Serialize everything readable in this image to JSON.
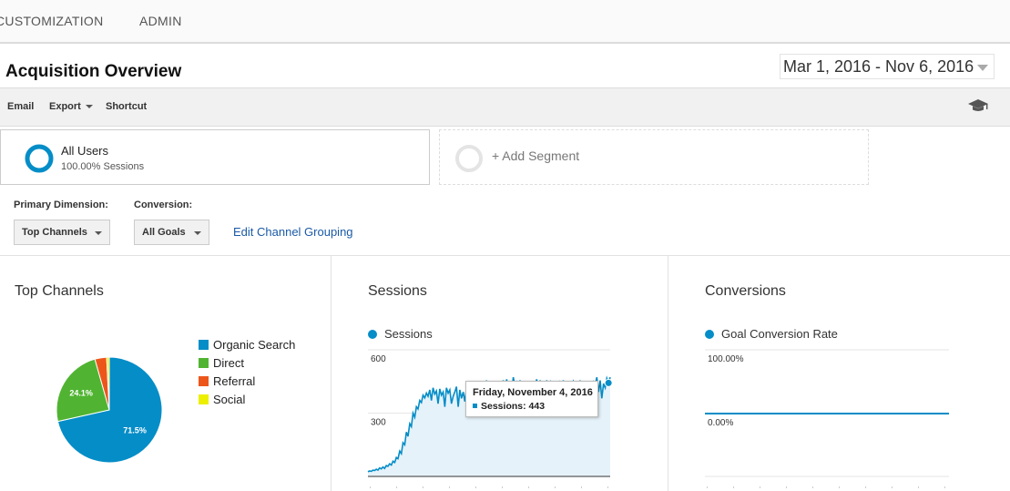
{
  "nav": {
    "items": [
      "CUSTOMIZATION",
      "ADMIN"
    ]
  },
  "page": {
    "title": "Acquisition Overview",
    "date_range": "Mar 1, 2016 - Nov 6, 2016"
  },
  "toolbar": {
    "email": "Email",
    "export": "Export",
    "shortcut": "Shortcut",
    "icon": "graduation-cap-icon"
  },
  "segments": {
    "all_users": {
      "title": "All Users",
      "subtitle": "100.00% Sessions"
    },
    "add_label": "+ Add Segment"
  },
  "dimension": {
    "primary_label": "Primary Dimension:",
    "primary_value": "Top Channels",
    "conversion_label": "Conversion:",
    "conversion_value": "All Goals",
    "edit_link": "Edit Channel Grouping"
  },
  "colors": {
    "accent": "#058dc7",
    "direct": "#50b432",
    "referral": "#ed561b",
    "social": "#edef00",
    "link": "#1a5aa6"
  },
  "panels": {
    "top_channels": {
      "title": "Top Channels"
    },
    "sessions": {
      "title": "Sessions",
      "legend": "Sessions",
      "tooltip": {
        "date": "Friday, November 4, 2016",
        "label": "Sessions:",
        "value": "443"
      }
    },
    "conversions": {
      "title": "Conversions",
      "legend": "Goal Conversion Rate"
    }
  },
  "chart_data": [
    {
      "type": "pie",
      "title": "Top Channels",
      "series": [
        {
          "name": "Organic Search",
          "value": 71.5,
          "label": "71.5%",
          "color": "#058dc7"
        },
        {
          "name": "Direct",
          "value": 24.1,
          "label": "24.1%",
          "color": "#50b432"
        },
        {
          "name": "Referral",
          "value": 3.6,
          "color": "#ed561b"
        },
        {
          "name": "Social",
          "value": 0.8,
          "color": "#edef00"
        }
      ]
    },
    {
      "type": "area",
      "title": "Sessions",
      "ylim": [
        0,
        600
      ],
      "yticks": [
        {
          "value": 600,
          "label": "600"
        },
        {
          "value": 300,
          "label": "300"
        }
      ],
      "series": [
        {
          "name": "Sessions",
          "values": [
            22,
            26,
            24,
            30,
            28,
            34,
            30,
            40,
            36,
            45,
            38,
            52,
            48,
            60,
            54,
            72,
            66,
            90,
            84,
            120,
            108,
            160,
            150,
            210,
            190,
            250,
            236,
            300,
            280,
            330,
            320,
            360,
            350,
            385,
            372,
            395,
            380,
            410,
            360,
            420,
            390,
            405,
            345,
            415,
            385,
            400,
            330,
            420,
            395,
            410,
            345,
            380,
            400,
            425,
            330,
            410,
            370,
            400,
            355,
            415,
            380,
            395,
            345,
            420,
            400,
            430,
            385,
            440,
            405,
            415,
            350,
            455,
            410,
            440,
            360,
            450,
            415,
            445,
            375,
            440,
            425,
            455,
            380,
            460,
            420,
            450,
            395,
            470,
            430,
            445,
            380,
            455,
            420,
            440,
            385,
            450,
            410,
            445,
            375,
            440,
            430,
            460,
            395,
            455,
            420,
            440,
            390,
            455,
            425,
            445,
            380,
            450,
            410,
            440,
            375,
            445,
            430,
            455,
            395,
            450,
            420,
            435,
            380,
            450,
            435,
            445,
            390,
            455,
            410,
            440,
            385,
            445,
            400,
            440,
            370,
            445,
            430,
            470,
            400,
            455,
            370,
            440,
            420,
            465,
            443,
            470
          ]
        }
      ]
    },
    {
      "type": "line",
      "title": "Conversions",
      "ylim": [
        0,
        100
      ],
      "yticks": [
        {
          "value": 100,
          "label": "100.00%"
        },
        {
          "value": 0,
          "label": "0.00%"
        }
      ],
      "series": [
        {
          "name": "Goal Conversion Rate",
          "values": [
            0,
            0
          ]
        }
      ]
    }
  ]
}
